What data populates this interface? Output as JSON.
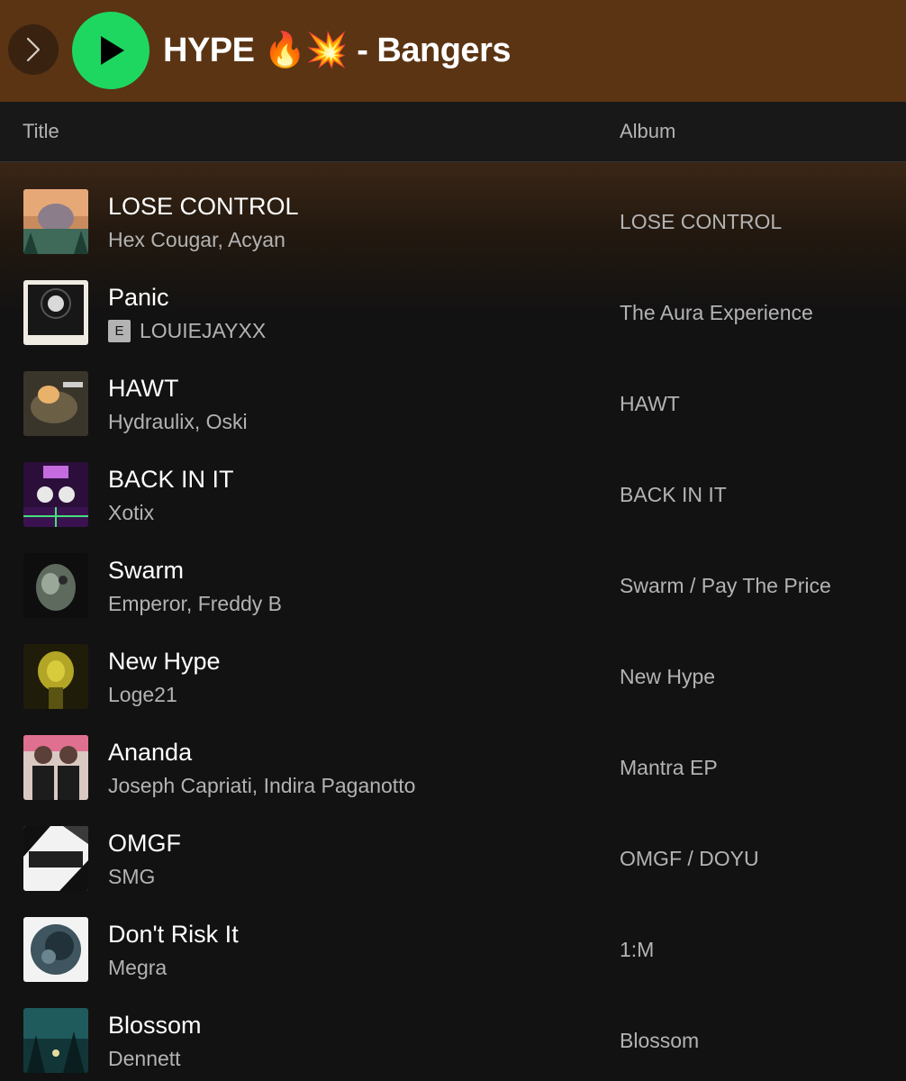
{
  "header": {
    "playlist_title": "HYPE 🔥💥 - Bangers",
    "play_color": "#1ed760",
    "bar_color": "#5a3413",
    "icons": {
      "forward": "chevron-right-icon",
      "play": "play-icon"
    }
  },
  "columns": {
    "title": "Title",
    "album": "Album"
  },
  "tracks": [
    {
      "title": "LOSE CONTROL",
      "artist": "Hex Cougar, Acyan",
      "album": "LOSE CONTROL",
      "explicit": false,
      "explicit_label": ""
    },
    {
      "title": "Panic",
      "artist": "LOUIEJAYXX",
      "album": "The Aura Experience",
      "explicit": true,
      "explicit_label": "E"
    },
    {
      "title": "HAWT",
      "artist": "Hydraulix, Oski",
      "album": "HAWT",
      "explicit": false,
      "explicit_label": ""
    },
    {
      "title": "BACK IN IT",
      "artist": "Xotix",
      "album": "BACK IN IT",
      "explicit": false,
      "explicit_label": ""
    },
    {
      "title": "Swarm",
      "artist": "Emperor, Freddy B",
      "album": "Swarm / Pay The Price",
      "explicit": false,
      "explicit_label": ""
    },
    {
      "title": "New Hype",
      "artist": "Loge21",
      "album": "New Hype",
      "explicit": false,
      "explicit_label": ""
    },
    {
      "title": "Ananda",
      "artist": "Joseph Capriati, Indira Paganotto",
      "album": "Mantra EP",
      "explicit": false,
      "explicit_label": ""
    },
    {
      "title": "OMGF",
      "artist": "SMG",
      "album": "OMGF / DOYU",
      "explicit": false,
      "explicit_label": ""
    },
    {
      "title": "Don't Risk It",
      "artist": "Megra",
      "album": "1:M",
      "explicit": false,
      "explicit_label": ""
    },
    {
      "title": "Blossom",
      "artist": "Dennett",
      "album": "Blossom",
      "explicit": false,
      "explicit_label": ""
    }
  ]
}
